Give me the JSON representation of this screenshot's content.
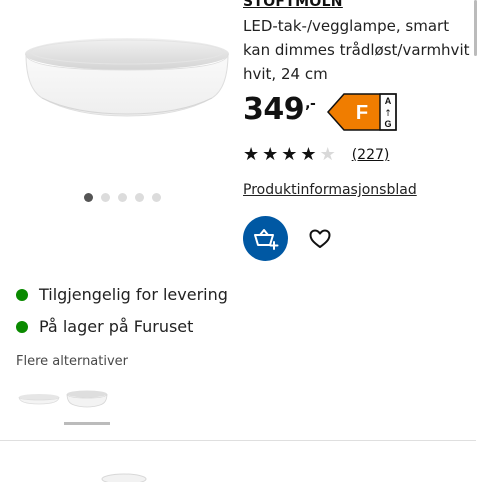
{
  "product": {
    "name": "STOFTMOLN",
    "description": "LED-tak-/vegglampe, smart kan dimmes trådløst/varmhvit hvit, 24 cm",
    "price": "349",
    "price_suffix": ",-",
    "energy_class": {
      "grade": "F",
      "scale_top": "A",
      "scale_arrow": "↑",
      "scale_bottom": "G",
      "color": "#f07d00"
    },
    "rating": {
      "stars": 4,
      "max": 5,
      "reviews": "(227)"
    },
    "datasheet_link": "Produktinformasjonsblad"
  },
  "gallery": {
    "image_count": 5,
    "active_index": 0
  },
  "actions": {
    "add_to_cart_icon": "cart-plus-icon",
    "favorite_icon": "heart-icon",
    "primary_color": "#0058a3"
  },
  "availability": [
    {
      "text": "Tilgjengelig for levering",
      "status_color": "#0a8a00"
    },
    {
      "text": "På lager på Furuset",
      "status_color": "#0a8a00"
    }
  ],
  "alternatives": {
    "title": "Flere alternativer",
    "items": [
      "thumb-flat",
      "thumb-rounded"
    ],
    "selected_index": 1
  }
}
